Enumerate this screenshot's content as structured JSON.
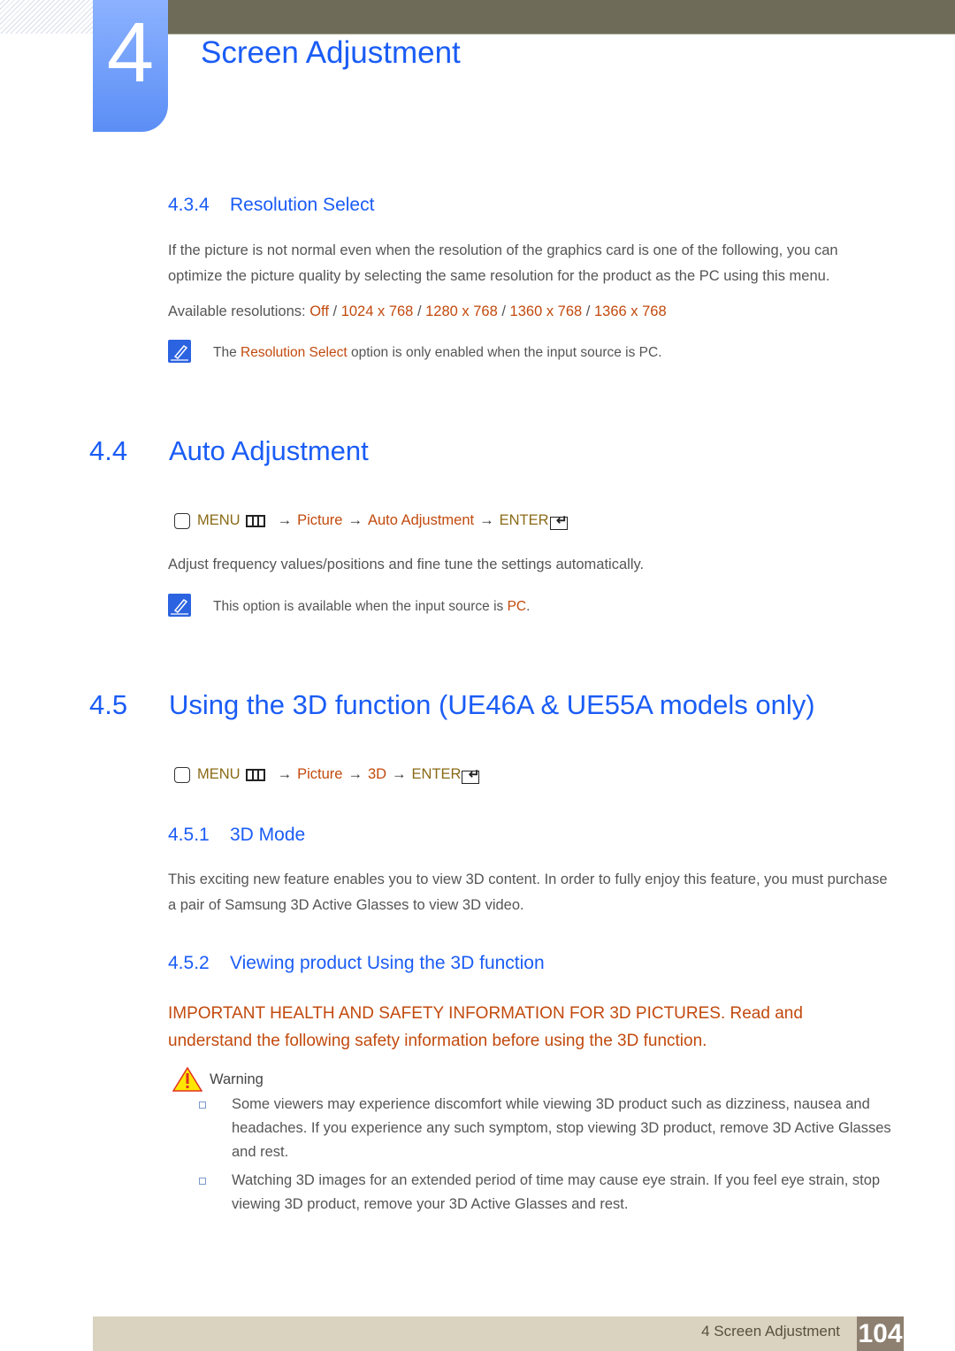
{
  "chapter": {
    "number": "4",
    "title": "Screen Adjustment"
  },
  "section_434": {
    "number": "4.3.4",
    "title": "Resolution Select",
    "body": "If the picture is not normal even when the resolution of the graphics card is one of the following, you can optimize the picture quality by selecting the same resolution for the product as the PC using this menu.",
    "resolutions_label": "Available resolutions: ",
    "resolutions": [
      "Off",
      "1024 x 768",
      "1280 x 768",
      "1360 x 768",
      "1366 x 768"
    ],
    "separator": " / ",
    "note": {
      "prefix": "The ",
      "highlight": "Resolution Select",
      "suffix": " option is only enabled when the input source is PC."
    }
  },
  "section_44": {
    "number": "4.4",
    "title": "Auto Adjustment",
    "menu_path": {
      "menu": "MENU",
      "arrow": "→",
      "steps": [
        "Picture",
        "Auto Adjustment"
      ],
      "enter": "ENTER"
    },
    "body": "Adjust frequency values/positions and fine tune the settings automatically.",
    "note": {
      "prefix": "This option is available when the input source is ",
      "highlight": "PC",
      "suffix": "."
    }
  },
  "section_45": {
    "number": "4.5",
    "title": "Using the 3D function (UE46A & UE55A models only)",
    "menu_path": {
      "menu": "MENU",
      "arrow": "→",
      "steps": [
        "Picture",
        "3D"
      ],
      "enter": "ENTER"
    }
  },
  "section_451": {
    "number": "4.5.1",
    "title": "3D Mode",
    "body": "This exciting new feature enables you to view 3D content. In order to fully enjoy this feature, you must purchase a pair of Samsung 3D Active Glasses to view 3D video."
  },
  "section_452": {
    "number": "4.5.2",
    "title": "Viewing product Using the 3D function",
    "important": "IMPORTANT HEALTH AND SAFETY INFORMATION FOR 3D PICTURES. Read and understand the following safety information before using the 3D function.",
    "warning_label": "Warning",
    "bullets": [
      "Some viewers may experience discomfort while viewing 3D product such as dizziness, nausea and headaches. If you experience any such symptom, stop viewing 3D product, remove 3D Active Glasses and rest.",
      "Watching 3D images for an extended period of time may cause eye strain. If you feel eye strain, stop viewing 3D product, remove your 3D Active Glasses and rest."
    ]
  },
  "footer": {
    "chapter_title": "4 Screen Adjustment",
    "page_number": "104"
  },
  "colors": {
    "heading_blue": "#1a5cf5",
    "highlight_orange": "#c24a0e",
    "menu_gold": "#8a6a16",
    "topbar": "#6e6c58",
    "footer_bg": "#d9d3bf"
  }
}
